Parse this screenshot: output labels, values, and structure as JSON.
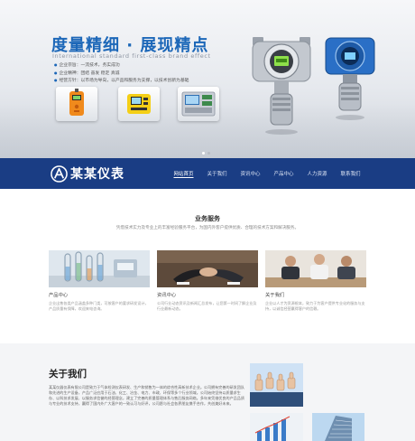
{
  "hero": {
    "title": "度量精细 · 展现精点",
    "subtitle": "International standard first-class brand effect",
    "bullets": [
      "企业宗旨：一流技术，务实成功",
      "企业精神：团结 奋发 稳定 真诚",
      "经营方针：以市场为导向，以产品和服务为支撑，以技术创新为基础"
    ],
    "thumbnails": [
      "orange-gas-detector-icon",
      "yellow-gas-detector-icon",
      "control-panel-icon"
    ],
    "devices": [
      "gas-transmitter-silver-icon",
      "gas-transmitter-blue-icon"
    ],
    "slides": 2,
    "active_slide": 1
  },
  "navbar": {
    "logo_text": "某某仪表",
    "items": [
      {
        "label": "网站首页",
        "active": true
      },
      {
        "label": "关于我们",
        "active": false
      },
      {
        "label": "资讯中心",
        "active": false
      },
      {
        "label": "产品中心",
        "active": false
      },
      {
        "label": "人力资源",
        "active": false
      },
      {
        "label": "联系我们",
        "active": false
      }
    ]
  },
  "business": {
    "title": "业务服务",
    "description": "凭借技术实力及专业上的丰富经验服务平台，为国内外客户提供优质、合理的技术方案和解决服务。",
    "cards": [
      {
        "title": "产品中心",
        "text": "企业出售各类产品涵盖多种门类，可按客户的要求研发设计，产品质量有保障，欢迎来电咨询。",
        "image": "test-tubes-photo"
      },
      {
        "title": "资讯中心",
        "text": "公司行业动态资讯及新闻汇总发布，让您第一时间了解企业及行业最新动态。",
        "image": "handshake-photo"
      },
      {
        "title": "关于我们",
        "text": "企业以人才为资源根本，致力于为客户提供专业化的服务与支持，以诚信经营赢得客户的信赖。",
        "image": "business-meeting-photo"
      }
    ]
  },
  "about": {
    "title": "关于我们",
    "text": "某某仪器仪表有限公司是致力于气体检测仪表研发、生产和销售为一体的综合性高新技术企业。公司拥有完善的研发团队和先进的生产设备，产品广泛应用于石油、化工、冶金、电力、市政、环保等多个行业领域。公司始终坚持以质量求生存、以科技求发展、以服务求信誉的经营理念，建立了完善的质量管理体系与售后服务网络。多年来凭借优良的产品品质与专业的技术支持，赢得了国内外广大客户的一致认可与好评，公司愿与社会各界朋友携手合作，共创美好未来。",
    "images": [
      "thumbs-up-team-photo",
      "growth-chart-photo",
      "office-building-photo"
    ]
  },
  "colors": {
    "brand_blue": "#1c67b8",
    "navbar_bg": "#1a3d84",
    "section_bg": "#f4f5f7"
  }
}
